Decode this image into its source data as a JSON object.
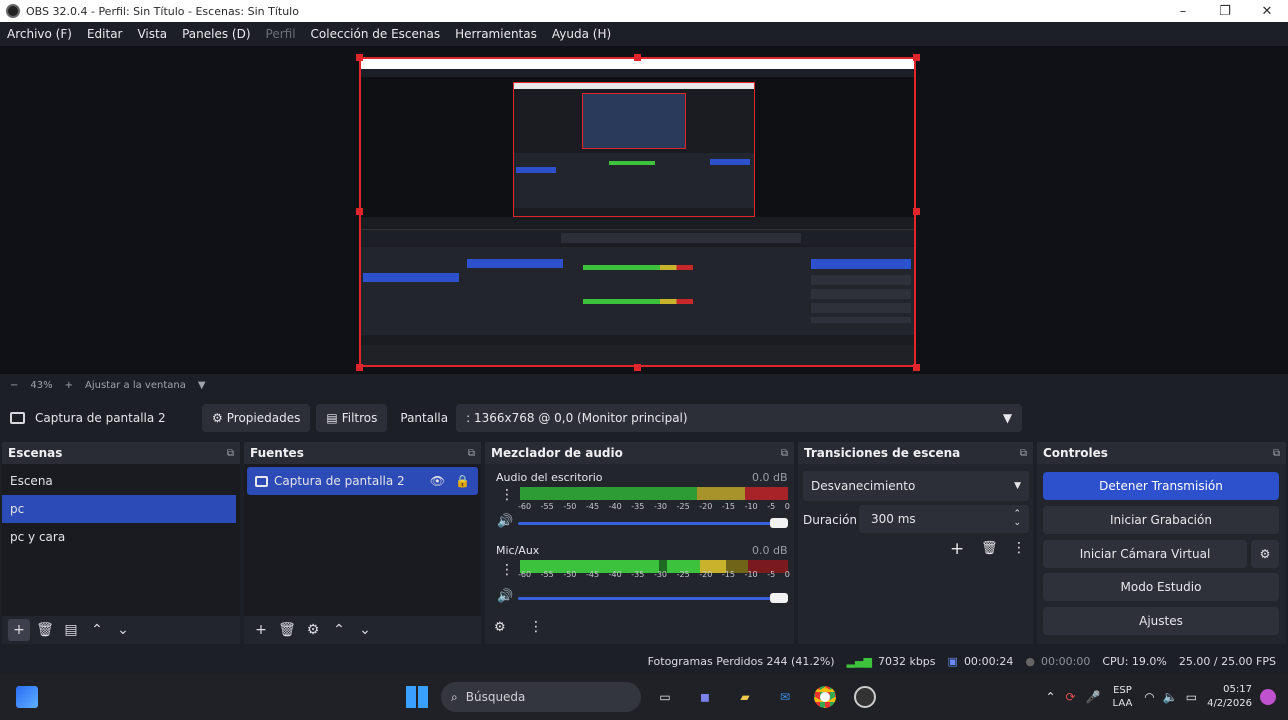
{
  "window": {
    "title": "OBS 32.0.4 - Perfil: Sin Título - Escenas: Sin Título"
  },
  "menu": [
    {
      "label": "Archivo (F)"
    },
    {
      "label": "Editar"
    },
    {
      "label": "Vista"
    },
    {
      "label": "Paneles (D)"
    },
    {
      "label": "Perfil",
      "disabled": true
    },
    {
      "label": "Colección de Escenas"
    },
    {
      "label": "Herramientas"
    },
    {
      "label": "Ayuda (H)"
    }
  ],
  "zoom": {
    "minus": "−",
    "value": "43%",
    "plus": "+",
    "fit": "Ajustar a la ventana"
  },
  "context": {
    "source_name": "Captura de pantalla 2",
    "properties": "Propiedades",
    "filters": "Filtros",
    "display_label": "Pantalla",
    "display_value": ": 1366x768 @ 0,0 (Monitor principal)"
  },
  "scenes": {
    "title": "Escenas",
    "items": [
      {
        "label": "Escena"
      },
      {
        "label": "pc"
      },
      {
        "label": "pc y cara"
      }
    ],
    "selected_index": 1
  },
  "sources": {
    "title": "Fuentes",
    "items": [
      {
        "label": "Captura de pantalla 2"
      }
    ]
  },
  "mixer": {
    "title": "Mezclador de audio",
    "ticks": [
      "-60",
      "-55",
      "-50",
      "-45",
      "-40",
      "-35",
      "-30",
      "-25",
      "-20",
      "-15",
      "-10",
      "-5",
      "0"
    ],
    "channels": [
      {
        "name": "Audio del escritorio",
        "db": "0.0 dB",
        "level": 1.0,
        "volume": 1.0
      },
      {
        "name": "Mic/Aux",
        "db": "0.0 dB",
        "level": 0.85,
        "volume": 1.0
      }
    ]
  },
  "transitions": {
    "title": "Transiciones de escena",
    "selected": "Desvanecimiento",
    "duration_label": "Duración",
    "duration_value": "300 ms"
  },
  "controls": {
    "title": "Controles",
    "stop_stream": "Detener Transmisión",
    "start_recording": "Iniciar Grabación",
    "virtual_cam": "Iniciar Cámara Virtual",
    "studio_mode": "Modo Estudio",
    "settings": "Ajustes"
  },
  "status": {
    "dropped_frames": "Fotogramas Perdidos 244 (41.2%)",
    "bitrate": "7032 kbps",
    "stream_time": "00:00:24",
    "rec_time": "00:00:00",
    "cpu": "CPU: 19.0%",
    "fps": "25.00 / 25.00 FPS"
  },
  "taskbar": {
    "search": "Búsqueda",
    "lang1": "ESP",
    "lang2": "LAA",
    "time": "05:17",
    "date": "4/2/2026"
  },
  "colors": {
    "accent": "#2d50cc",
    "selection_border": "#e0252b",
    "meter_green": "#3cc23c",
    "meter_yellow": "#c9b22c",
    "meter_red": "#c8282c"
  }
}
